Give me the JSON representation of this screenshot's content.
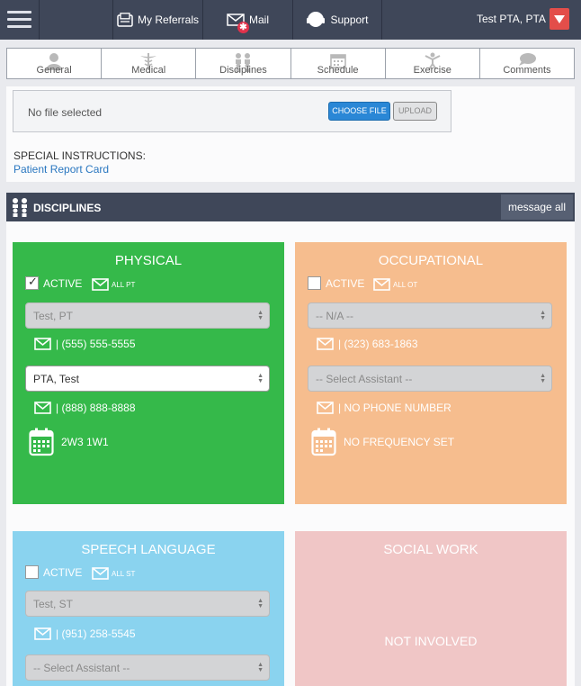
{
  "nav": {
    "referrals": "My Referrals",
    "mail": "Mail",
    "mail_badge": "✱",
    "support": "Support",
    "user": "Test PTA, PTA"
  },
  "tabs": [
    "General",
    "Medical",
    "Disciplines",
    "Schedule",
    "Exercise",
    "Comments"
  ],
  "file": {
    "status": "No file selected",
    "choose": "CHOOSE FILE",
    "upload": "UPLOAD"
  },
  "special": {
    "label": "SPECIAL INSTRUCTIONS:",
    "link": "Patient Report Card"
  },
  "disciplines": {
    "header": "DISCIPLINES",
    "message_all": "message all"
  },
  "cards": {
    "physical": {
      "title": "PHYSICAL",
      "active_label": "ACTIVE",
      "active": true,
      "all_label": "ALL PT",
      "therapist": "Test, PT",
      "therapist_phone": "| (555) 555-5555",
      "assistant": "PTA, Test",
      "assistant_phone": "| (888) 888-8888",
      "frequency": "2W3 1W1",
      "color": "#35b94a"
    },
    "occupational": {
      "title": "OCCUPATIONAL",
      "active_label": "ACTIVE",
      "active": false,
      "all_label": "ALL OT",
      "therapist": "-- N/A --",
      "therapist_phone": "| (323) 683-1863",
      "assistant": "-- Select Assistant --",
      "assistant_phone": "| NO PHONE NUMBER",
      "frequency": "NO FREQUENCY SET",
      "color": "#f6bd8e"
    },
    "speech": {
      "title": "SPEECH LANGUAGE",
      "active_label": "ACTIVE",
      "active": false,
      "all_label": "ALL ST",
      "therapist": "Test, ST",
      "therapist_phone": "| (951) 258-5545",
      "assistant": "-- Select Assistant --",
      "color": "#8ad3ef"
    },
    "social": {
      "title": "SOCIAL WORK",
      "status": "NOT INVOLVED",
      "color": "#f0c6c6"
    }
  }
}
